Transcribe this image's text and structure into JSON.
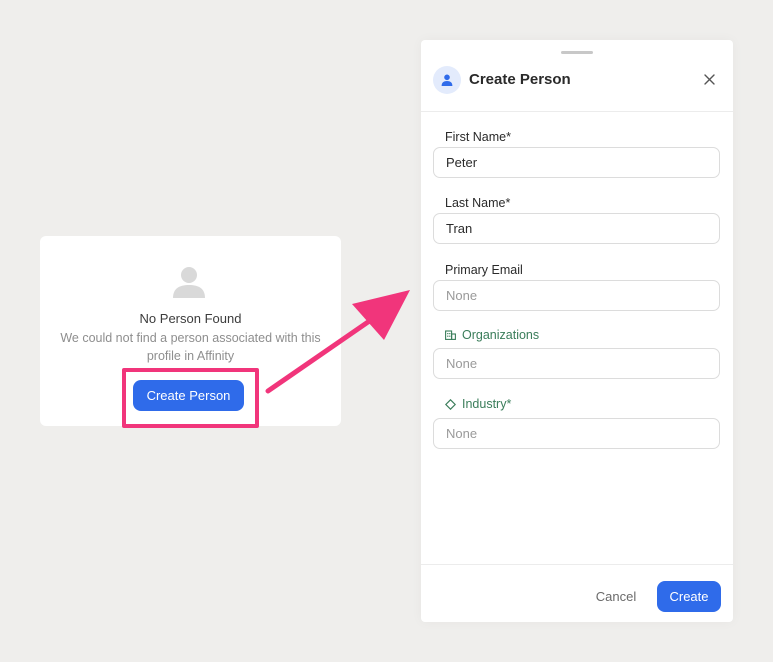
{
  "colors": {
    "accent": "#2f6bea",
    "highlight": "#f1357b",
    "attribute_label": "#3a7d5a"
  },
  "empty_state": {
    "icon": "person-icon",
    "title": "No Person Found",
    "description": "We could not find a person associated with this profile in Affinity",
    "button_label": "Create Person"
  },
  "panel": {
    "icon": "person-icon",
    "title": "Create Person",
    "close_icon": "close-icon",
    "fields": {
      "first_name": {
        "label": "First Name*",
        "value": "Peter"
      },
      "last_name": {
        "label": "Last Name*",
        "value": "Tran"
      },
      "primary_email": {
        "label": "Primary Email",
        "placeholder": "None"
      },
      "organizations": {
        "label": "Organizations",
        "icon": "building-icon",
        "placeholder": "None"
      },
      "industry": {
        "label": "Industry*",
        "icon": "diamond-icon",
        "placeholder": "None"
      }
    },
    "footer": {
      "cancel_label": "Cancel",
      "create_label": "Create"
    }
  }
}
